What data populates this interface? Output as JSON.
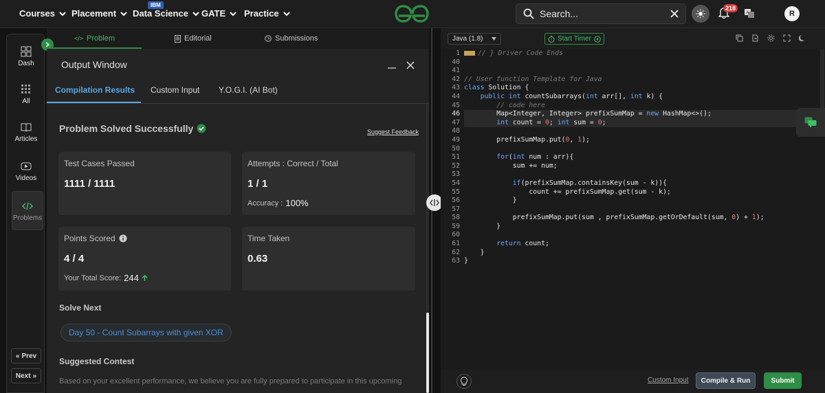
{
  "nav": {
    "items": [
      {
        "label": "Courses"
      },
      {
        "label": "Placement"
      },
      {
        "label": "Data Science"
      },
      {
        "label": "GATE"
      },
      {
        "label": "Practice"
      }
    ],
    "ibm_badge": "IBM",
    "search_placeholder": "Search...",
    "notification_count": "218",
    "avatar_initial": "R",
    "brand_color": "#2f8d46"
  },
  "rail": {
    "items": [
      {
        "label": "Dash",
        "icon": "dashboard-icon"
      },
      {
        "label": "All",
        "icon": "grid-icon"
      },
      {
        "label": "Articles",
        "icon": "book-icon"
      },
      {
        "label": "Videos",
        "icon": "play-icon"
      },
      {
        "label": "Problems",
        "icon": "code-icon"
      }
    ],
    "prev_label": "Prev",
    "next_label": "Next"
  },
  "problem_tabs": {
    "problem": "Problem",
    "editorial": "Editorial",
    "submissions": "Submissions"
  },
  "output": {
    "title": "Output Window",
    "tabs": [
      "Compilation Results",
      "Custom Input",
      "Y.O.G.I. (AI Bot)"
    ],
    "status": "Problem Solved Successfully",
    "feedback_link": "Suggest Feedback",
    "test_cases_label": "Test Cases Passed",
    "test_cases_value": "1111 / 1111",
    "attempts_label": "Attempts : Correct / Total",
    "attempts_value": "1 / 1",
    "accuracy_label": "Accuracy :",
    "accuracy_value": "100%",
    "points_label": "Points Scored",
    "points_value": "4 / 4",
    "total_score_label": "Your Total Score:",
    "total_score_value": "244",
    "time_label": "Time Taken",
    "time_value": "0.63",
    "solve_next_heading": "Solve Next",
    "solve_next_item": "Day 50 - Count Subarrays with given XOR",
    "contest_heading": "Suggested Contest",
    "contest_text": "Based on your excellent performance, we believe you are fully prepared to participate in this upcoming"
  },
  "editor": {
    "language": "Java (1.8)",
    "timer_label": "Start Timer",
    "line_numbers": [
      "1",
      "40",
      "41",
      "42",
      "43",
      "44",
      "45",
      "46",
      "47",
      "48",
      "49",
      "50",
      "51",
      "52",
      "53",
      "54",
      "55",
      "56",
      "57",
      "58",
      "59",
      "60",
      "61",
      "62",
      "63"
    ],
    "custom_input_label": "Custom Input",
    "compile_label": "Compile & Run",
    "submit_label": "Submit"
  }
}
